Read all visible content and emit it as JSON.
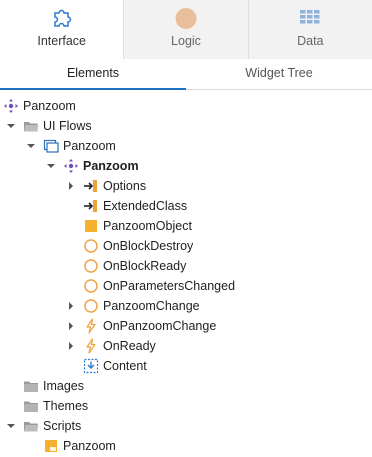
{
  "modes": [
    {
      "label": "Interface",
      "icon": "puzzle-icon",
      "active": true
    },
    {
      "label": "Logic",
      "icon": "logic-circle-icon",
      "active": false
    },
    {
      "label": "Data",
      "icon": "grid-icon",
      "active": false
    }
  ],
  "subtabs": [
    {
      "label": "Elements",
      "active": true
    },
    {
      "label": "Widget Tree",
      "active": false
    }
  ],
  "tree": [
    {
      "label": "Panzoom",
      "icon": "module-icon",
      "twisty": "none"
    },
    {
      "label": "UI Flows",
      "icon": "folder-open-icon",
      "twisty": "expanded"
    },
    {
      "label": "Panzoom",
      "icon": "uiflow-icon",
      "twisty": "expanded"
    },
    {
      "label": "Panzoom",
      "icon": "block-icon",
      "twisty": "expanded"
    },
    {
      "label": "Options",
      "icon": "input-parameter-icon",
      "twisty": "collapsed"
    },
    {
      "label": "ExtendedClass",
      "icon": "input-parameter-icon",
      "twisty": "none"
    },
    {
      "label": "PanzoomObject",
      "icon": "local-variable-icon",
      "twisty": "none"
    },
    {
      "label": "OnBlockDestroy",
      "icon": "action-circle-icon",
      "twisty": "none"
    },
    {
      "label": "OnBlockReady",
      "icon": "action-circle-icon",
      "twisty": "none"
    },
    {
      "label": "OnParametersChanged",
      "icon": "action-circle-icon",
      "twisty": "none"
    },
    {
      "label": "PanzoomChange",
      "icon": "action-circle-icon",
      "twisty": "collapsed"
    },
    {
      "label": "OnPanzoomChange",
      "icon": "event-bolt-icon",
      "twisty": "collapsed"
    },
    {
      "label": "OnReady",
      "icon": "event-bolt-icon",
      "twisty": "collapsed"
    },
    {
      "label": "Content",
      "icon": "placeholder-icon",
      "twisty": "none"
    },
    {
      "label": "Images",
      "icon": "folder-icon",
      "twisty": "none"
    },
    {
      "label": "Themes",
      "icon": "folder-icon",
      "twisty": "none"
    },
    {
      "label": "Scripts",
      "icon": "folder-open-icon",
      "twisty": "expanded"
    },
    {
      "label": "Panzoom",
      "icon": "script-js-icon",
      "twisty": "none"
    }
  ],
  "colors": {
    "accent": "#1d6fc4",
    "orange": "#f0a13a",
    "module_purple": "#6b4fbb",
    "logic_dot": "#e8bf9a"
  }
}
